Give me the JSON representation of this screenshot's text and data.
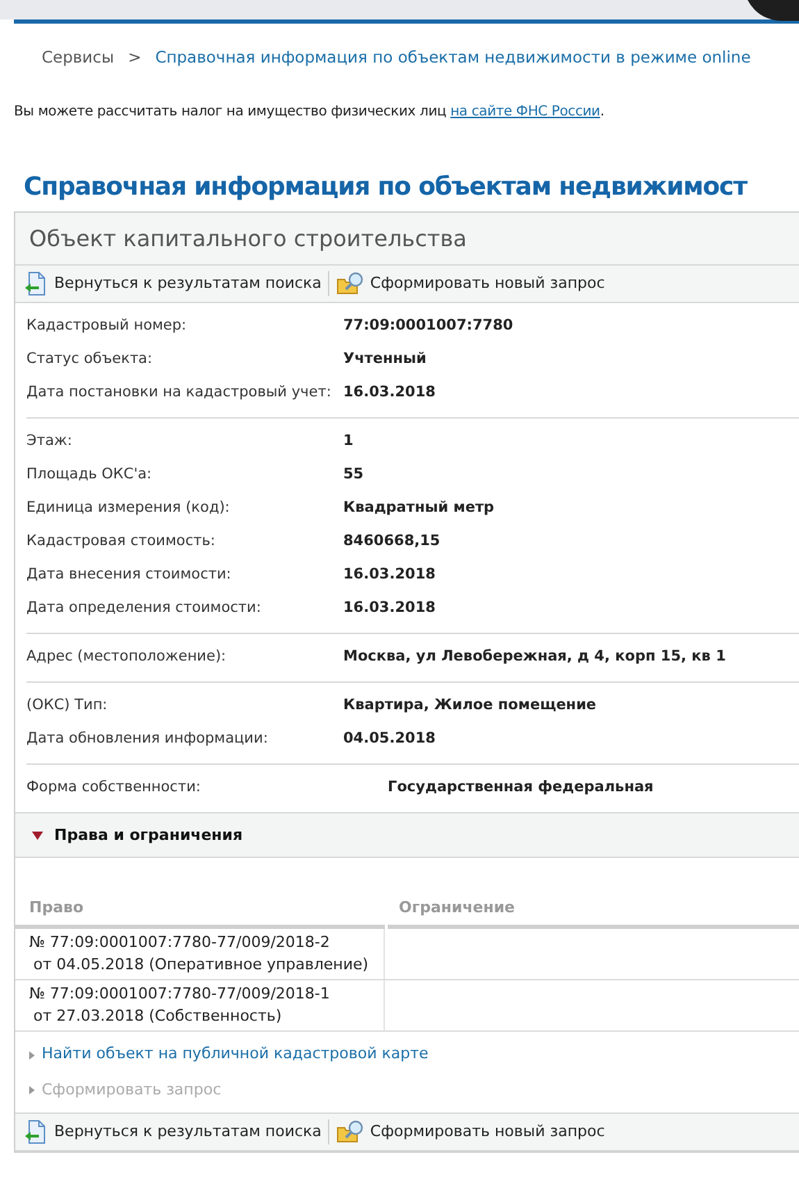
{
  "breadcrumb": {
    "items": [
      {
        "label": "Сервисы",
        "kind": "plain"
      },
      {
        "label": ">",
        "kind": "separator"
      },
      {
        "label": "Справочная информация по объектам недвижимости в режиме online",
        "kind": "link"
      }
    ]
  },
  "notice": {
    "text": "Вы можете рассчитать налог на имущество физических лиц ",
    "link": "на сайте ФНС России",
    "end": "."
  },
  "page_title": "Справочная информация по объектам недвижимост",
  "panel": {
    "title": "Объект капитального строительства",
    "toolbar_top": [
      {
        "label": "Вернуться к результатам поиска",
        "kind": "back"
      },
      {
        "label": "Сформировать новый запрос",
        "kind": "query"
      }
    ],
    "groups": [
      {
        "kind": "standard",
        "rows": [
          {
            "label": "Кадастровый номер:",
            "value": "77:09:0001007:7780"
          },
          {
            "label": "Статус объекта:",
            "value": "Учтенный"
          },
          {
            "label": "Дата постановки на кадастровый учет:",
            "value": "16.03.2018"
          }
        ]
      },
      {
        "kind": "standard",
        "rows": [
          {
            "label": "Этаж:",
            "value": "1"
          },
          {
            "label": "Площадь ОКС'a:",
            "value": "55"
          },
          {
            "label": "Единица измерения (код):",
            "value": "Квадратный метр"
          },
          {
            "label": "Кадастровая стоимость:",
            "value": "8460668,15"
          },
          {
            "label": "Дата внесения стоимости:",
            "value": "16.03.2018"
          },
          {
            "label": "Дата определения стоимости:",
            "value": "16.03.2018"
          }
        ]
      },
      {
        "kind": "standard",
        "rows": [
          {
            "label": "Адрес (местоположение):",
            "value": "Москва, ул Левобережная, д 4, корп 15, кв 1"
          }
        ]
      },
      {
        "kind": "standard",
        "rows": [
          {
            "label": "(ОКС) Тип:",
            "value": "Квартира, Жилое помещение"
          },
          {
            "label": "Дата обновления информации:",
            "value": "04.05.2018"
          }
        ]
      },
      {
        "kind": "offset",
        "rows": [
          {
            "label": "Форма собственности:",
            "value": "Государственная федеральная"
          }
        ]
      }
    ],
    "rights": {
      "title": "Права и ограничения",
      "expanded": true,
      "columns": [
        "Право",
        "Ограничение"
      ],
      "rows": [
        {
          "right": [
            "№ 77:09:0001007:7780-77/009/2018-2",
            "от 04.05.2018  (Оперативное управление)"
          ]
        },
        {
          "right": [
            "№ 77:09:0001007:7780-77/009/2018-1",
            "от 27.03.2018  (Собственность)"
          ]
        }
      ]
    },
    "links": [
      {
        "label": "Найти объект на публичной кадастровой карте",
        "disabled": false
      },
      {
        "label": "Сформировать запрос",
        "disabled": true
      }
    ],
    "toolbar_bottom": [
      {
        "label": "Вернуться к результатам поиска",
        "kind": "back"
      },
      {
        "label": "Сформировать новый запрос",
        "kind": "query"
      }
    ]
  }
}
